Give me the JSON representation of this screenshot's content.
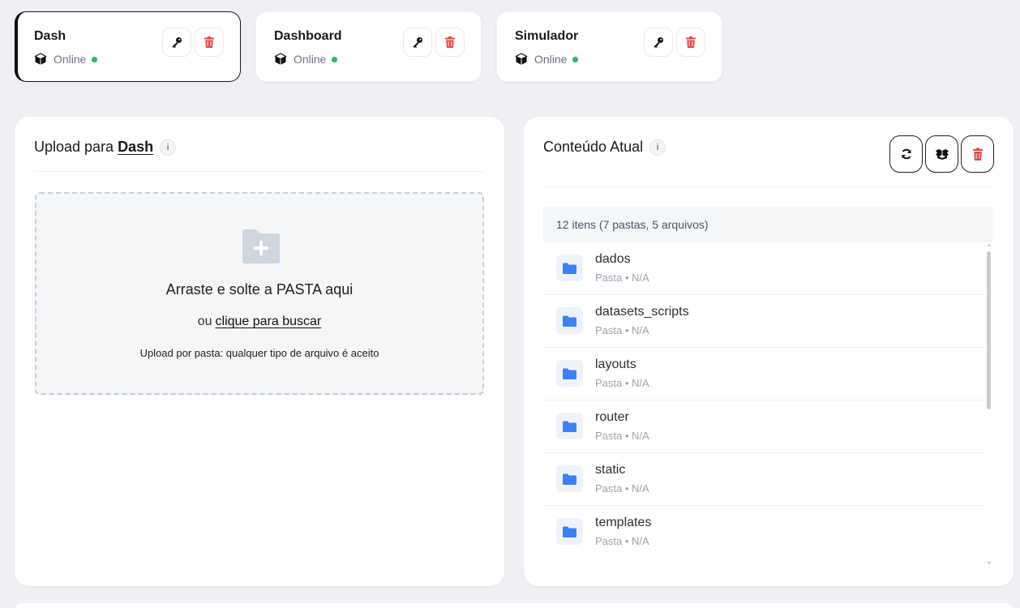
{
  "apps": [
    {
      "name": "Dash",
      "status": "Online",
      "active": true
    },
    {
      "name": "Dashboard",
      "status": "Online",
      "active": false
    },
    {
      "name": "Simulador",
      "status": "Online",
      "active": false
    }
  ],
  "upload": {
    "title_prefix": "Upload para",
    "title_target": "Dash",
    "info": "i",
    "drop_title": "Arraste e solte a PASTA aqui",
    "or_text": "ou",
    "browse_link": "clique para buscar",
    "hint": "Upload por pasta: qualquer tipo de arquivo é aceito"
  },
  "content": {
    "title": "Conteúdo Atual",
    "info": "i",
    "summary": "12 itens (7 pastas, 5 arquivos)",
    "items": [
      {
        "name": "dados",
        "meta": "Pasta • N/A"
      },
      {
        "name": "datasets_scripts",
        "meta": "Pasta • N/A"
      },
      {
        "name": "layouts",
        "meta": "Pasta • N/A"
      },
      {
        "name": "router",
        "meta": "Pasta • N/A"
      },
      {
        "name": "static",
        "meta": "Pasta • N/A"
      },
      {
        "name": "templates",
        "meta": "Pasta • N/A"
      }
    ]
  },
  "icons": {
    "app_type": "cube-icon",
    "key": "key-icon",
    "delete": "trash-icon",
    "refresh": "refresh-icon",
    "package": "box-icon",
    "folder": "folder-icon",
    "add_folder": "folder-plus-icon"
  },
  "colors": {
    "online_dot": "#22b573",
    "delete_red": "#e04848",
    "folder_blue": "#3b82f6"
  }
}
